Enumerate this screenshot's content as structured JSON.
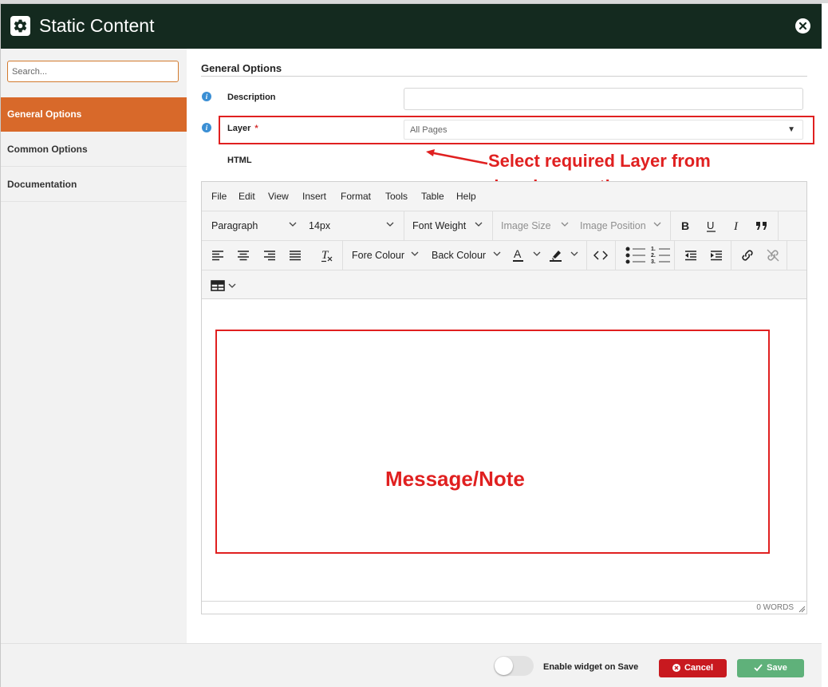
{
  "window": {
    "title": "Static Content",
    "logo_icon": "gear-icon",
    "close_icon": "close-icon"
  },
  "sidebar": {
    "search_placeholder": "Search...",
    "items": [
      {
        "label": "General Options",
        "active": true
      },
      {
        "label": "Common Options",
        "active": false
      },
      {
        "label": "Documentation",
        "active": false
      }
    ]
  },
  "main": {
    "section_title": "General Options",
    "description": {
      "label": "Description",
      "value": ""
    },
    "layer": {
      "label": "Layer",
      "required_mark": "*",
      "value": "All Pages"
    },
    "html_label": "HTML"
  },
  "editor": {
    "menu": [
      "File",
      "Edit",
      "View",
      "Insert",
      "Format",
      "Tools",
      "Table",
      "Help"
    ],
    "block_format": "Paragraph",
    "font_size": "14px",
    "font_weight": "Font Weight",
    "image_size": "Image Size",
    "image_position": "Image Position",
    "fore_colour": "Fore Colour",
    "back_colour": "Back Colour",
    "word_count": "0 WORDS"
  },
  "annotations": {
    "layer_note": "Select required Layer from\ndropdown option",
    "message_note": "Message/Note",
    "color": "#e02020"
  },
  "footer": {
    "toggle_label": "Enable widget on Save",
    "toggle_on": false,
    "cancel_label": "Cancel",
    "save_label": "Save"
  },
  "colors": {
    "header_bg": "#142a1f",
    "accent_orange": "#d8692a",
    "cancel_red": "#c8191f",
    "save_green": "#5fb17a"
  }
}
